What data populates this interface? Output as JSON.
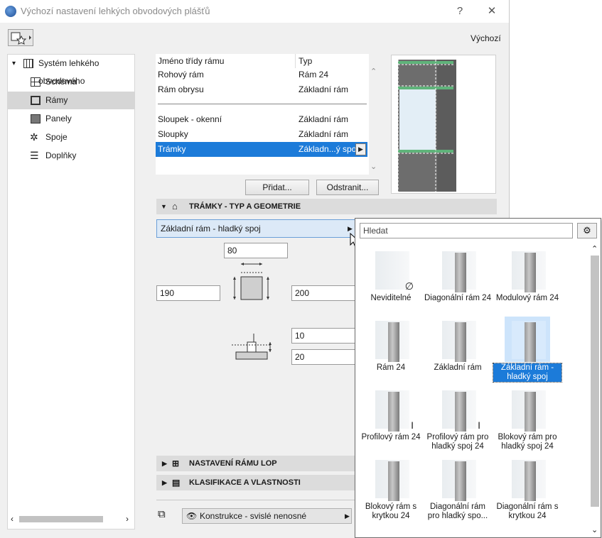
{
  "window": {
    "title": "Výchozí nastavení lehkých obvodových plášťů",
    "help": "?",
    "close": "✕",
    "default_link": "Výchozí"
  },
  "tree": {
    "root": "Systém lehkého obvodového",
    "items": [
      {
        "label": "Schéma",
        "icon": "grid-icon"
      },
      {
        "label": "Rámy",
        "icon": "frame-icon",
        "selected": true
      },
      {
        "label": "Panely",
        "icon": "panel-icon"
      },
      {
        "label": "Spoje",
        "icon": "joint-icon"
      },
      {
        "label": "Doplňky",
        "icon": "accessory-icon"
      }
    ]
  },
  "frame_list": {
    "header": {
      "name": "Jméno třídy rámu",
      "type": "Typ"
    },
    "rows": [
      {
        "name": "Rohový rám",
        "type": "Rám 24"
      },
      {
        "name": "Rám obrysu",
        "type": "Základní rám"
      },
      {
        "name": "Sloupek - okenní",
        "type": "Základní rám"
      },
      {
        "name": "Sloupky",
        "type": "Základní rám"
      },
      {
        "name": "Trámky",
        "type": "Základn...ý spoj",
        "selected": true
      }
    ],
    "add_button": "Přidat...",
    "remove_button": "Odstranit..."
  },
  "sections": {
    "geometry": "TRÁMKY - TYP A GEOMETRIE",
    "lop": "NASTAVENÍ RÁMU LOP",
    "classification": "KLASIFIKACE A VLASTNOSTI"
  },
  "geometry": {
    "type_selector": "Základní rám - hladký spoj",
    "width": "80",
    "depth_left": "190",
    "depth_right": "200",
    "offset_top": "10",
    "offset_bottom": "20"
  },
  "layer": {
    "value": "Konstrukce - svislé nenosné"
  },
  "popup": {
    "search_placeholder": "Hledat",
    "tiles": [
      {
        "label": "Neviditelné",
        "symbol": "∅"
      },
      {
        "label": "Diagonální rám 24"
      },
      {
        "label": "Modulový rám 24"
      },
      {
        "label": "Rám 24"
      },
      {
        "label": "Základní rám"
      },
      {
        "label": "Základní rám - hladký spoj",
        "selected": true
      },
      {
        "label": "Profilový rám 24",
        "symbol": "I"
      },
      {
        "label": "Profilový rám pro hladký spoj 24",
        "symbol": "I"
      },
      {
        "label": "Blokový rám pro hladký spoj 24"
      },
      {
        "label": "Blokový rám s krytkou 24"
      },
      {
        "label": "Diagonální rám pro hladký spo..."
      },
      {
        "label": "Diagonální rám s krytkou 24"
      }
    ]
  },
  "colors": {
    "accent": "#1c7bd9",
    "frame_gray": "#6b6b6b",
    "glass": "#e3eef6",
    "gasket": "#5fb37a"
  }
}
